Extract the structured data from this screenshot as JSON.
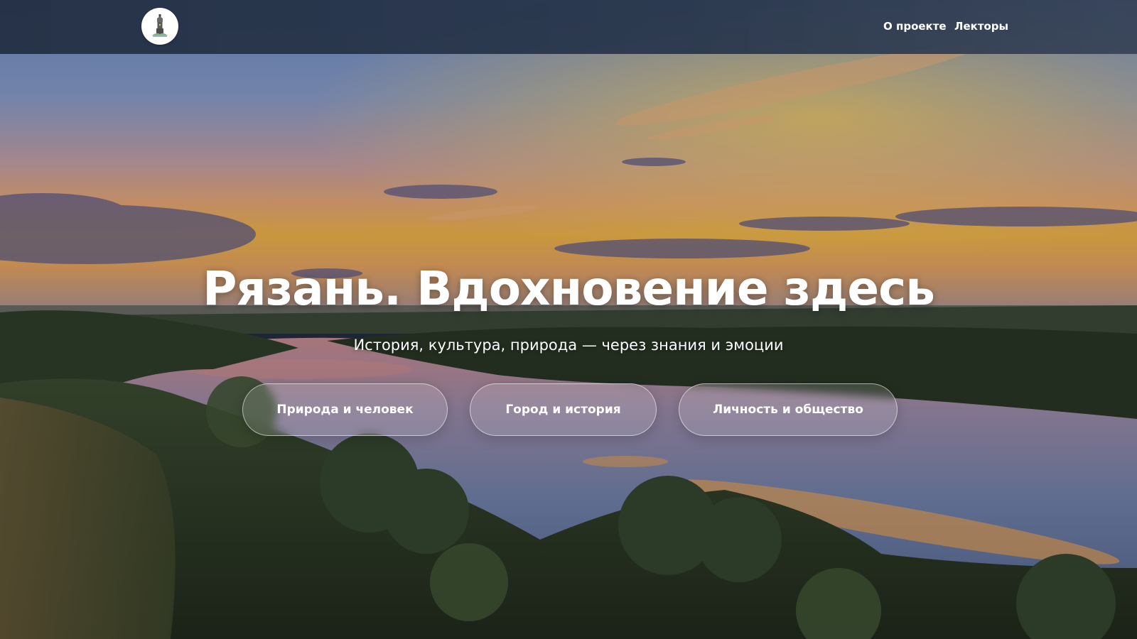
{
  "header": {
    "logo_icon": "church-tower-logo-icon",
    "nav": [
      {
        "label": "О проекте"
      },
      {
        "label": "Лекторы"
      }
    ]
  },
  "hero": {
    "title": "Рязань. Вдохновение здесь",
    "subtitle": "История, культура, природа — через знания и эмоции",
    "buttons": [
      {
        "label": "Природа и человек"
      },
      {
        "label": "Город и история"
      },
      {
        "label": "Личность и общество"
      }
    ]
  },
  "colors": {
    "header_bg": "#243044",
    "text": "#ffffff",
    "sky_top": "#6f8fc4",
    "sunset": "#f3b437",
    "river": "#5e6f93",
    "foliage": "#2c3a22"
  }
}
